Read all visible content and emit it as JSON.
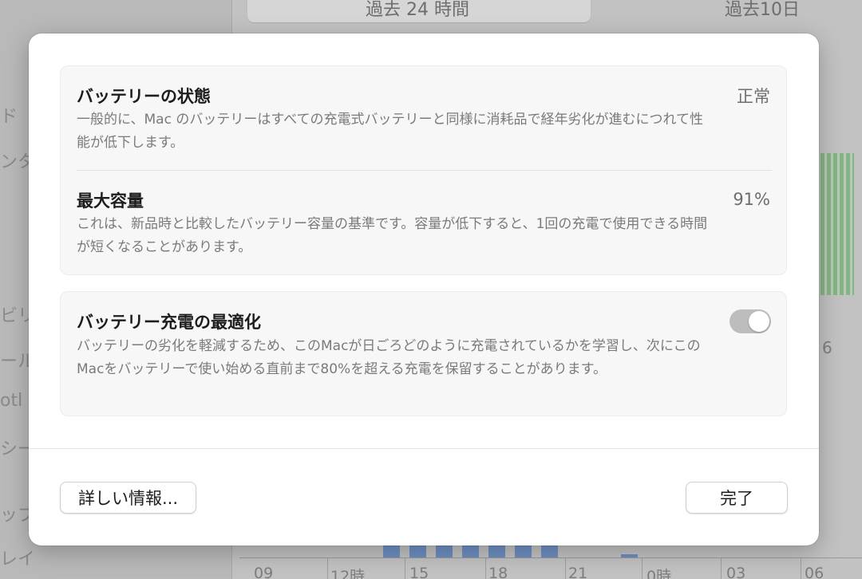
{
  "background": {
    "segment_tabs": [
      "過去 24 時間",
      "過去10日"
    ],
    "sidebar_fragments": [
      "ド",
      "ンタ",
      "ビリ",
      "ール",
      "otl",
      "シー",
      "ップ",
      "レイ"
    ],
    "chart_fragment_label": "6",
    "axis_labels": [
      "09",
      "12時",
      "15",
      "18",
      "21",
      "0時",
      "03",
      "06"
    ]
  },
  "dialog": {
    "battery_health": {
      "title": "バッテリーの状態",
      "value": "正常",
      "description": "一般的に、Mac のバッテリーはすべての充電式バッテリーと同様に消耗品で経年劣化が進むにつれて性能が低下します。"
    },
    "max_capacity": {
      "title": "最大容量",
      "value": "91%",
      "description": "これは、新品時と比較したバッテリー容量の基準です。容量が低下すると、1回の充電で使用できる時間が短くなることがあります。"
    },
    "optimized_charging": {
      "title": "バッテリー充電の最適化",
      "description": "バッテリーの劣化を軽減するため、このMacが日ごろどのように充電されているかを学習し、次にこのMacをバッテリーで使い始める直前まで80%を超える充電を保留することがあります。",
      "enabled": true
    },
    "buttons": {
      "more_info": "詳しい情報...",
      "done": "完了"
    }
  },
  "colors": {
    "toggle_on_dimmed": "#bdbdbd",
    "background_dim": "#c2c2c2"
  }
}
